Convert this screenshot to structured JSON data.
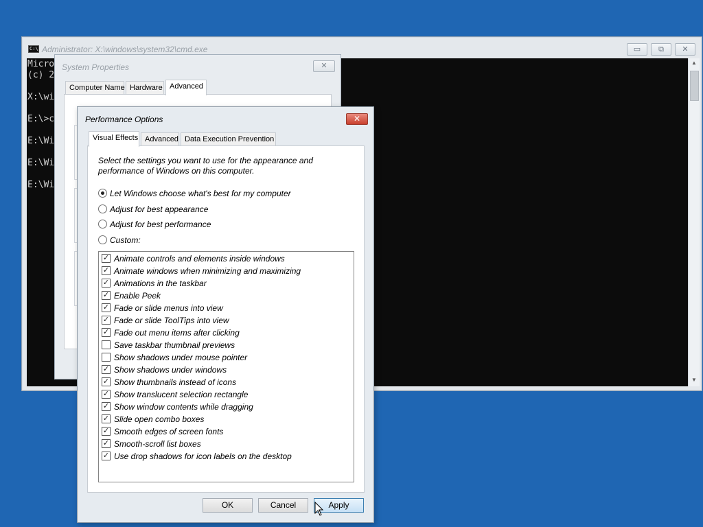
{
  "cmd": {
    "title": "Administrator: X:\\windows\\system32\\cmd.exe",
    "icon_label": "C:\\",
    "lines": [
      "Micro",
      "(c) 2",
      "",
      "X:\\wi",
      "",
      "E:\\>c",
      "",
      "E:\\Wi",
      "",
      "E:\\Wi",
      "",
      "E:\\Wi"
    ],
    "minimize_glyph": "▭",
    "restore_glyph": "⧉",
    "close_glyph": "✕"
  },
  "system_properties": {
    "title": "System Properties",
    "close_glyph": "✕",
    "tabs": [
      "Computer Name",
      "Hardware",
      "Advanced"
    ],
    "active_tab": "Advanced"
  },
  "performance_options": {
    "title": "Performance Options",
    "close_glyph": "✕",
    "tabs": [
      "Visual Effects",
      "Advanced",
      "Data Execution Prevention"
    ],
    "active_tab": "Visual Effects",
    "description": "Select the settings you want to use for the appearance and performance of Windows on this computer.",
    "radio_options": [
      {
        "label": "Let Windows choose what's best for my computer",
        "selected": true
      },
      {
        "label": "Adjust for best appearance",
        "selected": false
      },
      {
        "label": "Adjust for best performance",
        "selected": false
      },
      {
        "label": "Custom:",
        "selected": false
      }
    ],
    "effects": [
      {
        "label": "Animate controls and elements inside windows",
        "checked": true
      },
      {
        "label": "Animate windows when minimizing and maximizing",
        "checked": true
      },
      {
        "label": "Animations in the taskbar",
        "checked": true
      },
      {
        "label": "Enable Peek",
        "checked": true
      },
      {
        "label": "Fade or slide menus into view",
        "checked": true
      },
      {
        "label": "Fade or slide ToolTips into view",
        "checked": true
      },
      {
        "label": "Fade out menu items after clicking",
        "checked": true
      },
      {
        "label": "Save taskbar thumbnail previews",
        "checked": false
      },
      {
        "label": "Show shadows under mouse pointer",
        "checked": false
      },
      {
        "label": "Show shadows under windows",
        "checked": true
      },
      {
        "label": "Show thumbnails instead of icons",
        "checked": true
      },
      {
        "label": "Show translucent selection rectangle",
        "checked": true
      },
      {
        "label": "Show window contents while dragging",
        "checked": true
      },
      {
        "label": "Slide open combo boxes",
        "checked": true
      },
      {
        "label": "Smooth edges of screen fonts",
        "checked": true
      },
      {
        "label": "Smooth-scroll list boxes",
        "checked": true
      },
      {
        "label": "Use drop shadows for icon labels on the desktop",
        "checked": true
      }
    ],
    "buttons": {
      "ok": "OK",
      "cancel": "Cancel",
      "apply": "Apply"
    }
  },
  "colors": {
    "desktop": "#1f66b3",
    "console_bg": "#0c0c0c",
    "close_red": "#c8402e",
    "default_button": "#c6e0f5"
  }
}
